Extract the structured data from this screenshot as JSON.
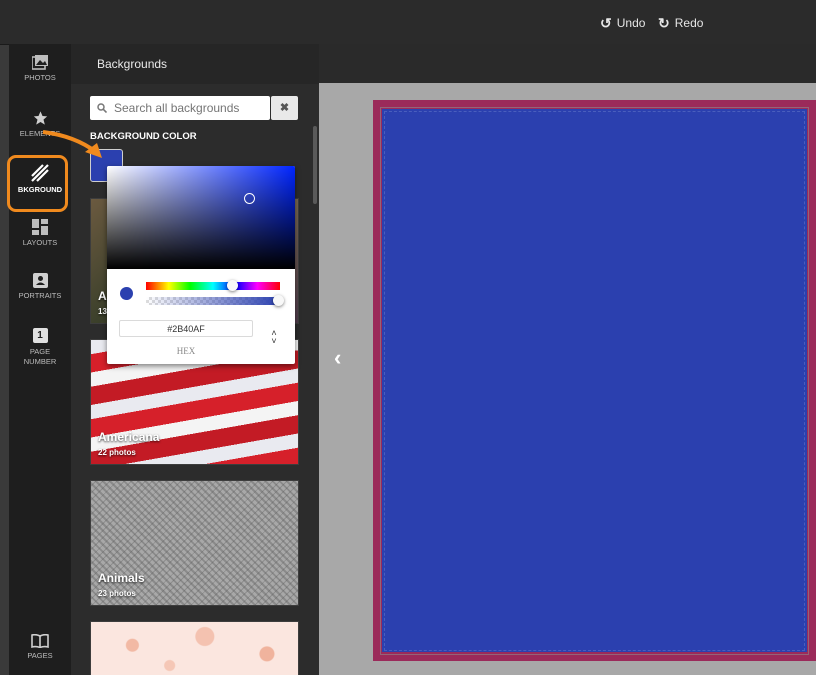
{
  "topbar": {
    "undo_label": "Undo",
    "redo_label": "Redo"
  },
  "rail": {
    "items": [
      {
        "label": "PHOTOS",
        "icon": "photos-icon"
      },
      {
        "label": "ELEMENTS",
        "icon": "star-icon"
      },
      {
        "label": "BKGROUND",
        "icon": "background-icon"
      },
      {
        "label": "LAYOUTS",
        "icon": "layouts-icon"
      },
      {
        "label": "PORTRAITS",
        "icon": "portrait-icon"
      },
      {
        "label": "PAGE NUMBER",
        "icon": "page-number-icon"
      }
    ],
    "page_number_glyph": "1",
    "pages_label": "PAGES"
  },
  "panel": {
    "title": "Backgrounds",
    "search_placeholder": "Search all backgrounds",
    "background_color_label": "BACKGROUND COLOR",
    "current_color": "#2B40AF",
    "categories": [
      {
        "title": "A",
        "count": "13"
      },
      {
        "title": "Americana",
        "count": "22 photos"
      },
      {
        "title": "Animals",
        "count": "23 photos"
      }
    ]
  },
  "color_picker": {
    "hex_value": "#2B40AF",
    "mode_label": "HEX",
    "hue_color": "#0025FF"
  },
  "canvas": {
    "page_color": "#2B40AF",
    "border_color": "#9B2A5A"
  }
}
